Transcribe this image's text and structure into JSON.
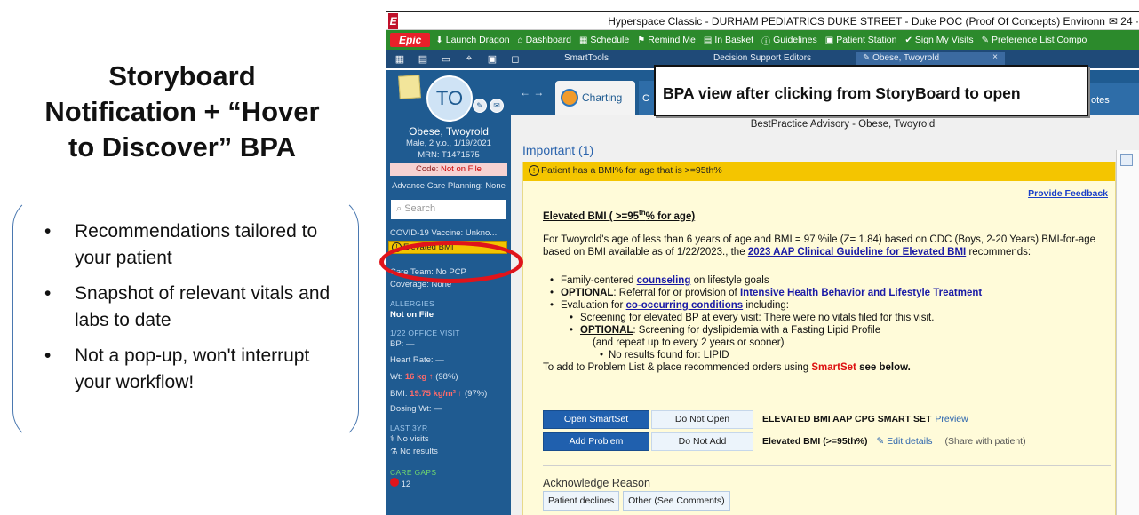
{
  "slide": {
    "title_lines": [
      "Storyboard",
      "Notification + “Hover",
      "to Discover” BPA"
    ],
    "bullets": [
      "Recommendations tailored to your patient",
      "Snapshot of relevant vitals and labs to date",
      "Not a pop-up, won't interrupt your workflow!"
    ],
    "bullet_glyph": "•"
  },
  "window": {
    "title": "Hyperspace Classic - DURHAM PEDIATRICS DUKE STREET - Duke POC (Proof Of Concepts) Environn",
    "title_right": "✉ 24 ·"
  },
  "toolbar": {
    "epic_label": "Epic",
    "items": [
      {
        "icon": "⬇",
        "label": "Launch Dragon"
      },
      {
        "icon": "⌂",
        "label": "Dashboard"
      },
      {
        "icon": "▦",
        "label": "Schedule"
      },
      {
        "icon": "⚑",
        "label": "Remind Me"
      },
      {
        "icon": "▤",
        "label": "In Basket"
      },
      {
        "icon": "ⓘ",
        "label": "Guidelines"
      },
      {
        "icon": "▣",
        "label": "Patient Station"
      },
      {
        "icon": "✔",
        "label": "Sign My Visits"
      },
      {
        "icon": "✎",
        "label": "Preference List Compo"
      }
    ]
  },
  "tabs": {
    "icons": [
      "▦",
      "▤",
      "▭",
      "⌖",
      "▣",
      "◻"
    ],
    "smarttools": "SmartTools",
    "dse": "Decision Support Editors",
    "patient": "✎ Obese, Twoyrold",
    "close": "×"
  },
  "patient": {
    "initials": "TO",
    "name": "Obese, Twoyrold",
    "demo": "Male, 2 y.o., 1/19/2021",
    "mrn": "MRN: T1471575",
    "code_label": "Code:",
    "code_value": "Not on File",
    "acp": "Advance Care Planning: None",
    "search_placeholder": "Search",
    "covid": "COVID-19 Vaccine: Unkno...",
    "bmi_flag": "Elevated BMI",
    "warn_glyph": "!",
    "care_team": "Care Team: No PCP",
    "coverage": "Coverage: None",
    "allergies_head": "ALLERGIES",
    "allergies_val": "Not on File",
    "visit_head": "1/22 OFFICE VISIT",
    "bp": "BP: —",
    "hr": "Heart Rate: —",
    "wt_label": "Wt:",
    "wt_val": "16 kg ↑",
    "wt_pct": "(98%)",
    "bmi_label": "BMI:",
    "bmi_val": "19.75 kg/m² ↑",
    "bmi_pct": "(97%)",
    "dosing": "Dosing Wt: —",
    "last3yr_head": "LAST 3YR",
    "no_visits": "No visits",
    "no_results": "No results",
    "care_gaps_head": "CARE GAPS",
    "care_gaps_val": "12"
  },
  "main": {
    "arrows": "← →",
    "charting": "Charting",
    "other_tab": "C",
    "notes_tab": "otes"
  },
  "callout": "BPA view after clicking from StoryBoard to open",
  "bpa": {
    "window_title": "BestPractice Advisory - Obese, Twoyrold",
    "important": "Important (1)",
    "banner": "Patient has a BMI% for age that is >=95th%",
    "feedback": "Provide Feedback",
    "heading_pre": "Elevated BMI ( >=95",
    "heading_sup": "th",
    "heading_post": "% for age)",
    "para_1": "For Twoyrold's age of less than 6 years of age and BMI = 97 %ile (Z= 1.84) based on CDC (Boys, 2-20 Years) BMI-for-age based on BMI available as of 1/22/2023., the",
    "para_link": "2023 AAP Clinical Guideline for Elevated BMI",
    "para_2": "recommends:",
    "li1_pre": "Family-centered",
    "li1_link": "counseling",
    "li1_post": "on lifestyle goals",
    "li2_opt": "OPTIONAL",
    "li2_pre": ": Referral for or provision of",
    "li2_link": "Intensive Health Behavior and Lifestyle Treatment",
    "li3_pre": "Evaluation for",
    "li3_link": "co-occurring conditions",
    "li3_post": "including:",
    "li3a": "Screening for elevated BP at every visit: There were no vitals filed for this visit.",
    "li3b_opt": "OPTIONAL",
    "li3b": ": Screening for dyslipidemia with a Fasting Lipid Profile",
    "li3b_cont": "(and repeat up to every 2 years or sooner)",
    "li3b_sub": "No results found for: LIPID",
    "tail_pre": "To add to Problem List & place recommended orders using",
    "tail_smartset": "SmartSet",
    "tail_post": "see below.",
    "open_smartset": "Open SmartSet",
    "do_not_open": "Do Not Open",
    "smartset_name": "ELEVATED BMI AAP CPG SMART SET",
    "preview": "Preview",
    "add_problem": "Add Problem",
    "do_not_add": "Do Not Add",
    "problem_name": "Elevated BMI (>=95th%)",
    "edit_details": "✎ Edit details",
    "share": "(Share with patient)",
    "ack_label": "Acknowledge Reason",
    "ack_1": "Patient declines",
    "ack_2": "Other (See Comments)"
  }
}
